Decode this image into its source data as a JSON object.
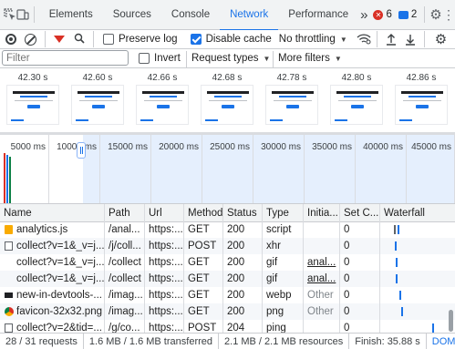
{
  "tabs": {
    "items": [
      "Elements",
      "Sources",
      "Console",
      "Network",
      "Performance"
    ],
    "active": "Network",
    "more": "»",
    "errors_count": "6",
    "messages_count": "2"
  },
  "toolbar": {
    "preserve_log": "Preserve log",
    "preserve_log_checked": false,
    "disable_cache": "Disable cache",
    "disable_cache_checked": true,
    "throttling": "No throttling"
  },
  "filterbar": {
    "filter_placeholder": "Filter",
    "invert": "Invert",
    "request_types": "Request types",
    "more_filters": "More filters"
  },
  "screenshots": {
    "times": [
      "42.30 s",
      "42.60 s",
      "42.66 s",
      "42.68 s",
      "42.78 s",
      "42.80 s",
      "42.86 s"
    ],
    "heading": "A Powerful Web.",
    "subheading": "Made Easier."
  },
  "overview": {
    "ticks": [
      "5000 ms",
      "10000 ms",
      "15000 ms",
      "20000 ms",
      "25000 ms",
      "30000 ms",
      "35000 ms",
      "40000 ms",
      "45000 ms"
    ]
  },
  "table": {
    "columns": [
      "Name",
      "Path",
      "Url",
      "Method",
      "Status",
      "Type",
      "Initia...",
      "Set C...",
      "Waterfall"
    ],
    "rows": [
      {
        "icon": "js",
        "name": "analytics.js",
        "path": "/anal...",
        "url": "https:...",
        "method": "GET",
        "status": "200",
        "type": "script",
        "initiator": "",
        "setc": "0"
      },
      {
        "icon": "doc",
        "name": "collect?v=1&_v=j...",
        "path": "/j/coll...",
        "url": "https:...",
        "method": "POST",
        "status": "200",
        "type": "xhr",
        "initiator": "",
        "setc": "0"
      },
      {
        "icon": "none",
        "name": "collect?v=1&_v=j...",
        "path": "/collect",
        "url": "https:...",
        "method": "GET",
        "status": "200",
        "type": "gif",
        "initiator": "anal...",
        "setc": "0"
      },
      {
        "icon": "none",
        "name": "collect?v=1&_v=j...",
        "path": "/collect",
        "url": "https:...",
        "method": "GET",
        "status": "200",
        "type": "gif",
        "initiator": "anal...",
        "setc": "0"
      },
      {
        "icon": "img",
        "name": "new-in-devtools-...",
        "path": "/imag...",
        "url": "https:...",
        "method": "GET",
        "status": "200",
        "type": "webp",
        "initiator": "Other",
        "setc": "0"
      },
      {
        "icon": "chrome",
        "name": "favicon-32x32.png",
        "path": "/imag...",
        "url": "https:...",
        "method": "GET",
        "status": "200",
        "type": "png",
        "initiator": "Other",
        "setc": "0"
      },
      {
        "icon": "doc",
        "name": "collect?v=2&tid=...",
        "path": "/g/co...",
        "url": "https:...",
        "method": "POST",
        "status": "204",
        "type": "ping",
        "initiator": "",
        "setc": "0"
      }
    ]
  },
  "status": {
    "requests": "28 / 31 requests",
    "transferred": "1.6 MB / 1.6 MB transferred",
    "resources": "2.1 MB / 2.1 MB resources",
    "finish": "Finish: 35.88 s",
    "domcontent": "DOMCon"
  },
  "colors": {
    "accent": "#1a73e8",
    "error": "#d93025",
    "waterfall_blue": "#1a73e8",
    "waterfall_gray": "#5f6368"
  }
}
